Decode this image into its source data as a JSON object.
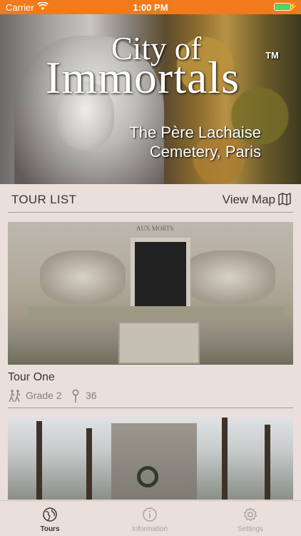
{
  "status_bar": {
    "carrier": "Carrier",
    "time": "1:00 PM"
  },
  "hero": {
    "title_line1": "City of",
    "title_line2": "Immortals",
    "trademark": "TM",
    "subtitle_line1": "The Père Lachaise",
    "subtitle_line2": "Cemetery, Paris"
  },
  "list_header": {
    "title": "TOUR LIST",
    "view_map_label": "View Map"
  },
  "tours": [
    {
      "title": "Tour One",
      "grade": "Grade 2",
      "stops": "36",
      "image_inscription": "AUX MORTS"
    }
  ],
  "tab_bar": {
    "tabs": [
      {
        "label": "Tours",
        "icon": "globe-icon",
        "active": true
      },
      {
        "label": "Information",
        "icon": "info-icon",
        "active": false
      },
      {
        "label": "Settings",
        "icon": "gear-icon",
        "active": false
      }
    ]
  },
  "colors": {
    "status_bar": "#f07a1c",
    "background": "#eadfdb",
    "text": "#3b3430",
    "muted": "#8a7f79"
  }
}
